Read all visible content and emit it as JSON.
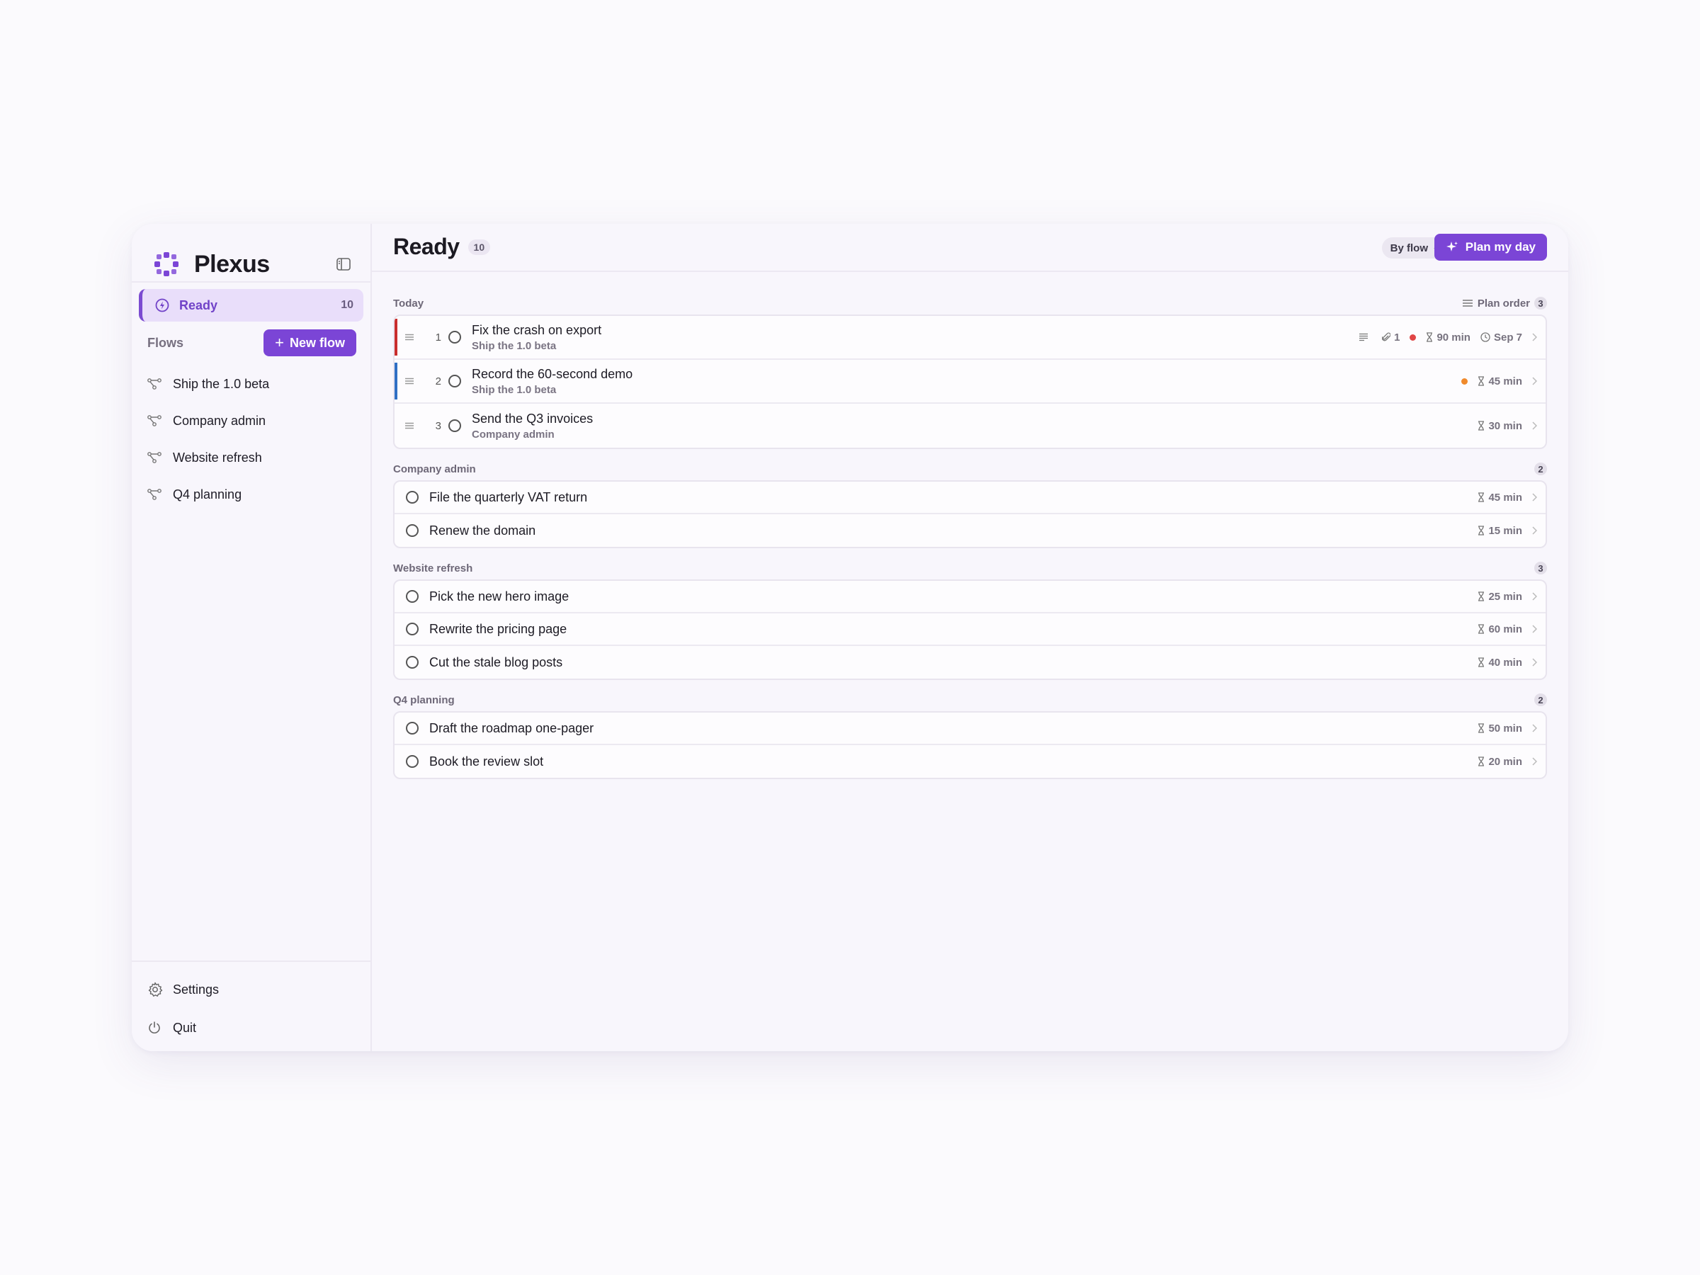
{
  "app": {
    "name": "Plexus"
  },
  "sidebar": {
    "ready_label": "Ready",
    "ready_count": "10",
    "flows_label": "Flows",
    "new_flow_label": "New flow",
    "flows": [
      "Ship the 1.0 beta",
      "Company admin",
      "Website refresh",
      "Q4 planning"
    ],
    "settings_label": "Settings",
    "quit_label": "Quit"
  },
  "header": {
    "title": "Ready",
    "count": "10",
    "group_by": "By flow",
    "plan_label": "Plan my day"
  },
  "today": {
    "label": "Today",
    "plan_order_label": "Plan order",
    "count": "3",
    "tasks": [
      {
        "num": "1",
        "title": "Fix the crash on export",
        "flow": "Ship the 1.0 beta",
        "attachments": "1",
        "duration": "90 min",
        "due": "Sep 7",
        "priority_color": "#e04545",
        "stripe_color": "#c92d2d"
      },
      {
        "num": "2",
        "title": "Record the 60-second demo",
        "flow": "Ship the 1.0 beta",
        "duration": "45 min",
        "priority_color": "#f08a2c",
        "stripe_color": "#2f6fc4"
      },
      {
        "num": "3",
        "title": "Send the Q3 invoices",
        "flow": "Company admin",
        "duration": "30 min"
      }
    ]
  },
  "groups": [
    {
      "label": "Company admin",
      "count": "2",
      "tasks": [
        {
          "title": "File the quarterly VAT return",
          "duration": "45 min"
        },
        {
          "title": "Renew the domain",
          "duration": "15 min"
        }
      ]
    },
    {
      "label": "Website refresh",
      "count": "3",
      "tasks": [
        {
          "title": "Pick the new hero image",
          "duration": "25 min"
        },
        {
          "title": "Rewrite the pricing page",
          "duration": "60 min"
        },
        {
          "title": "Cut the stale blog posts",
          "duration": "40 min"
        }
      ]
    },
    {
      "label": "Q4 planning",
      "count": "2",
      "tasks": [
        {
          "title": "Draft the roadmap one-pager",
          "duration": "50 min"
        },
        {
          "title": "Book the review slot",
          "duration": "20 min"
        }
      ]
    }
  ]
}
